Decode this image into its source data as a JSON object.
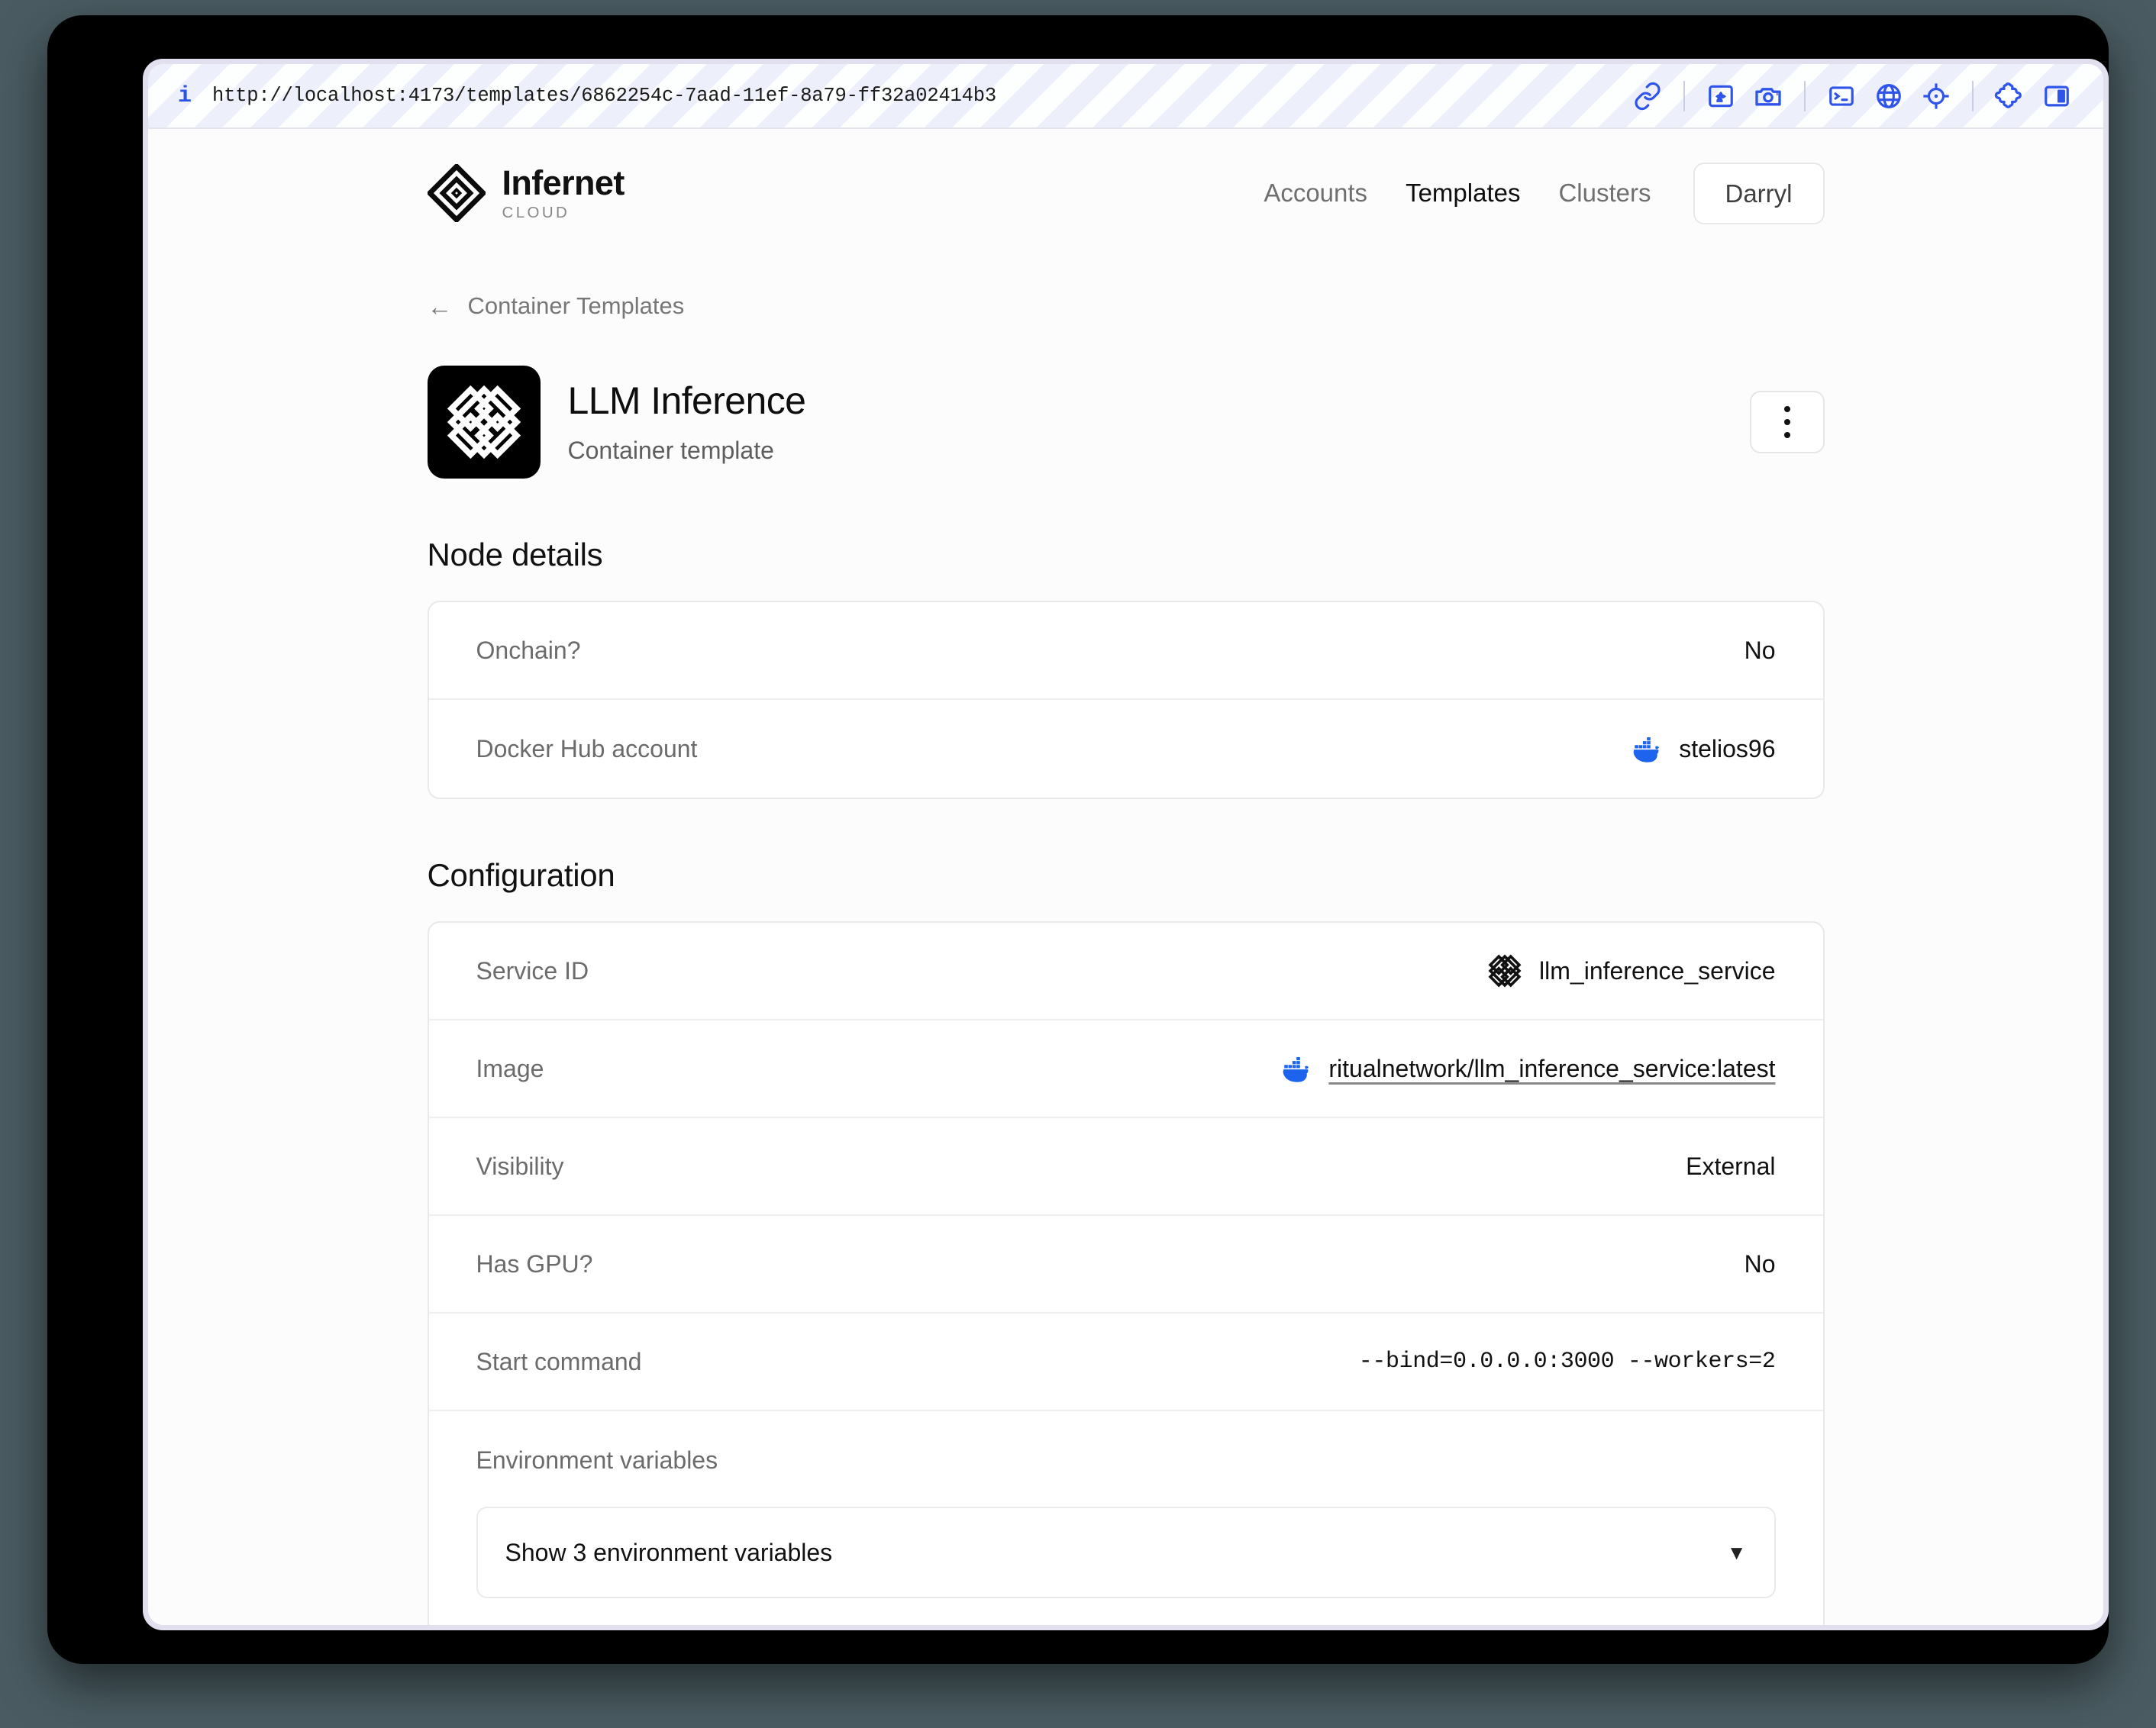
{
  "browser": {
    "url": "http://localhost:4173/templates/6862254c-7aad-11ef-8a79-ff32a02414b3",
    "info_icon": "info-icon",
    "toolbar_icons": [
      "link-icon",
      "image-icon",
      "camera-icon",
      "terminal-icon",
      "globe-icon",
      "crosshair-icon",
      "puzzle-icon",
      "split-panel-icon"
    ]
  },
  "brand": {
    "name": "Infernet",
    "sub": "CLOUD",
    "logo_icon": "infernet-diamond-logo"
  },
  "nav": {
    "items": [
      {
        "label": "Accounts",
        "active": false
      },
      {
        "label": "Templates",
        "active": true
      },
      {
        "label": "Clusters",
        "active": false
      }
    ],
    "account_label": "Darryl"
  },
  "breadcrumb": {
    "arrow": "←",
    "label": "Container Templates"
  },
  "template": {
    "title": "LLM Inference",
    "subtitle": "Container template",
    "avatar_icon": "endless-knot-icon",
    "menu_icon": "kebab-menu-icon"
  },
  "node_details": {
    "title": "Node details",
    "rows": [
      {
        "label": "Onchain?",
        "value": "No",
        "icon": null
      },
      {
        "label": "Docker Hub account",
        "value": "stelios96",
        "icon": "docker-icon"
      }
    ]
  },
  "configuration": {
    "title": "Configuration",
    "rows": [
      {
        "label": "Service ID",
        "value": "llm_inference_service",
        "icon": "endless-knot-icon",
        "mono": false,
        "link": false
      },
      {
        "label": "Image",
        "value": "ritualnetwork/llm_inference_service:latest",
        "icon": "docker-icon",
        "mono": false,
        "link": true
      },
      {
        "label": "Visibility",
        "value": "External",
        "icon": null,
        "mono": false,
        "link": false
      },
      {
        "label": "Has GPU?",
        "value": "No",
        "icon": null,
        "mono": false,
        "link": false
      },
      {
        "label": "Start command",
        "value": "--bind=0.0.0.0:3000 --workers=2",
        "icon": null,
        "mono": true,
        "link": false
      }
    ],
    "env": {
      "label": "Environment variables",
      "select_label": "Show 3 environment variables",
      "chevron": "▼"
    }
  },
  "colors": {
    "accent_blue": "#2f54ea",
    "docker_blue": "#1d63ed",
    "desktop_bg": "#4a5c62",
    "frame": "#000000",
    "window_border": "#e2e0ee"
  }
}
